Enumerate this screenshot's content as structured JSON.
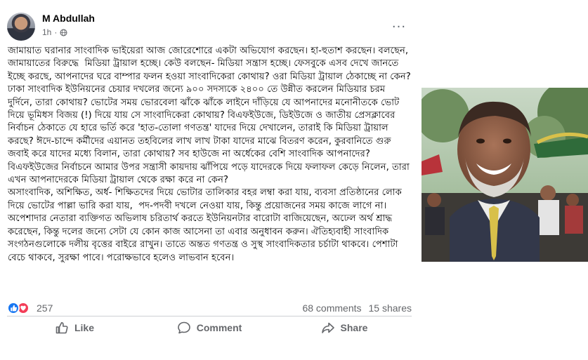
{
  "post": {
    "author": "M Abdullah",
    "time": "1h",
    "dot": "·",
    "more": "···",
    "text": "জামায়াত ঘরানার সাংবাদিক ভাইয়েরা আজ জোরেশোরে একটা অভিযোগ করছেন। হা-হুতাশ করছেন। বলছেন, জামায়াতের বিরুদ্ধে  মিডিয়া ট্রায়াল হচ্ছে। কেউ বলছেন- মিডিয়া সন্ত্রাস হচ্ছে। ফেসবুকে এসব দেখে জানতে ইচ্ছে করছে, আপনাদের ঘরে বাম্পার ফলন হওয়া সাংবাদিকেরা কোথায়? ওরা মিডিয়া ট্রায়াল ঠেকাচ্ছে না কেন? ঢাকা সাংবাদিক ইউনিয়নের চেয়ার দখলের জন্যে ৯০০ সদস্যকে ২৪০০ তে উন্নীত করলেন মিডিয়ার চরম দুর্দিনে, তারা কোথায়? ভোটের সময় ভোরবেলা ঝাঁকে ঝাঁকে লাইনে দাঁড়িয়ে যে আপনাদের মনোনীতকে ভোট দিয়ে ভূমিধস বিজয় (!) দিয়ে যায় সে সাংবাদিকেরা কোথায়? বিএফইউজে, ডিইউজে ও জাতীয় প্রেসক্লাবের নির্বাচন ঠেকাতে যে হারে ভর্তি করে 'হাত-তোলা গণতন্ত্র' যাদের দিয়ে দেখালেন, তারাই কি মিডিয়া ট্রায়াল করছে? ঈদে-চান্দে কর্মীদের এয়ানত তহবিলের লাখ লাখ টাকা যাদের মাঝে বিতরণ করেন, কুরবানিতে গুরু জবাই করে যাদের মধ্যে বিলান, তারা কোথায়? সব হাউজে না অর্ধেকের বেশি সাংবাদিক আপনাদের?  বিএফইউজের নির্বাচনে আমার উপর সন্ত্রাসী কায়দায় ঝাঁপিয়ে পড়ে যাদেরকে দিয়ে ফলাফল কেড়ে নিলেন, তারা এখন আপনাদেরকে মিডিয়া ট্রায়াল থেকে রক্ষা করে না কেন?\nঅসাংবাদিক, অশিক্ষিত, অর্ধ- শিক্ষিতদের দিয়ে ভোটার তালিকার বহর লম্বা করা যায়, ব্যবসা প্রতিষ্ঠানের লোক দিয়ে ভোটের পাল্লা ভারি করা যায়,  পদ-পদবী দখলে নেওয়া যায়, কিন্তু প্রয়োজনের সময় কাজে লাগে না। অপেশাদার নেতারা ব্যক্তিগত অভিলাষ চরিতার্থ করতে ইউনিয়নটার বারোটা বাজিয়েছেন, অঢেল অর্থ শ্রাদ্ধ করেছেন, কিন্তু দলের জন্যে সেটা যে কোন কাজ আসেনা তা এবার অনুধাবন করুন। ঐতিহ্যবাহী সাংবাদিক সংগঠনগুলোকে দলীয় বৃত্তের বাইরে রাখুন। তাতে অন্তত গণতন্ত্র ও সুস্থ সাংবাদিকতার চর্চাটা থাকবে। পেশাটা বেচে থাকবে, সুরক্ষা পাবে। পরোক্ষভাবে হলেও লাভবান হবেন।"
  },
  "reactions": {
    "count": "257",
    "comments": "68 comments",
    "shares": "15 shares"
  },
  "actions": {
    "like": "Like",
    "comment": "Comment",
    "share": "Share"
  },
  "colors": {
    "like_blue": "#1877f2",
    "love_red": "#f33e58",
    "meta_gray": "#65676b"
  }
}
